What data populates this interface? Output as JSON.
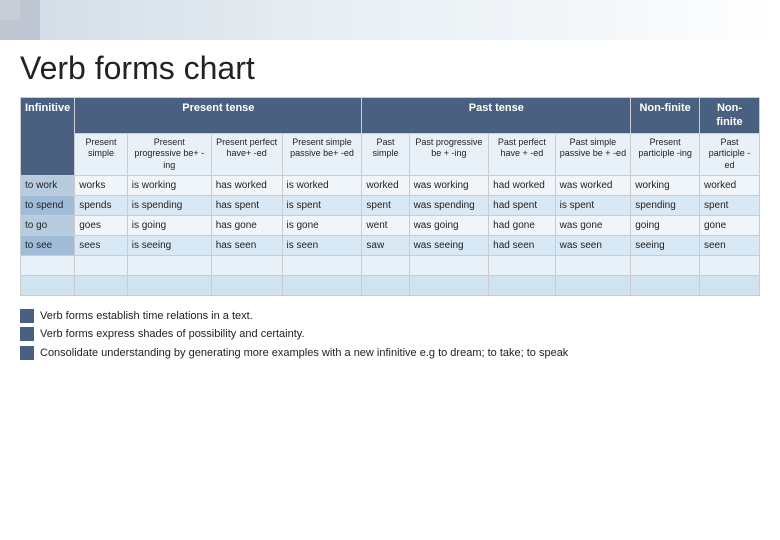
{
  "title": "Verb forms chart",
  "table": {
    "header1": {
      "nonfinite_left": "Non-finite",
      "present_tense": "Present tense",
      "past_tense": "Past tense",
      "nonfinite_right1": "Non-finite",
      "nonfinite_right2": "Non-finite"
    },
    "header2": {
      "col0": "Infinitive",
      "col1": "Present simple",
      "col2": "Present progressive be+ -ing",
      "col3": "Present perfect have+ -ed",
      "col4": "Present simple passive be+ -ed",
      "col5": "Past simple",
      "col6": "Past progressive be + -ing",
      "col7": "Past perfect have + -ed",
      "col8": "Past simple passive be + -ed",
      "col9": "Present participle -ing",
      "col10": "Past participle -ed"
    },
    "rows": [
      {
        "col0": "to work",
        "col1": "works",
        "col2": "is working",
        "col3": "has worked",
        "col4": "is worked",
        "col5": "worked",
        "col6": "was working",
        "col7": "had worked",
        "col8": "was worked",
        "col9": "working",
        "col10": "worked"
      },
      {
        "col0": "to spend",
        "col1": "spends",
        "col2": "is spending",
        "col3": "has spent",
        "col4": "is spent",
        "col5": "spent",
        "col6": "was spending",
        "col7": "had spent",
        "col8": "is spent",
        "col9": "spending",
        "col10": "spent"
      },
      {
        "col0": "to go",
        "col1": "goes",
        "col2": "is going",
        "col3": "has gone",
        "col4": "is gone",
        "col5": "went",
        "col6": "was going",
        "col7": "had gone",
        "col8": "was gone",
        "col9": "going",
        "col10": "gone"
      },
      {
        "col0": "to see",
        "col1": "sees",
        "col2": "is seeing",
        "col3": "has seen",
        "col4": "is seen",
        "col5": "saw",
        "col6": "was seeing",
        "col7": "had seen",
        "col8": "was seen",
        "col9": "seeing",
        "col10": "seen"
      }
    ]
  },
  "notes": [
    "Verb forms establish time relations in a text.",
    "Verb forms express shades of possibility and certainty.",
    "Consolidate understanding by generating more examples with a new infinitive e.g to dream; to take; to speak"
  ]
}
